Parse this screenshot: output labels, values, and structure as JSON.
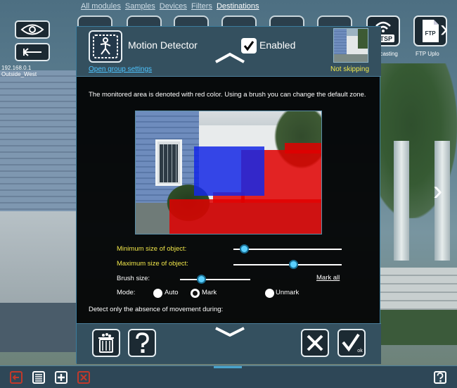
{
  "nav": {
    "items": [
      "All modules",
      "Samples",
      "Devices",
      "Filters",
      "Destinations"
    ],
    "active": "Destinations"
  },
  "camera": {
    "ip": "192.168.0.1",
    "name": "Outside_West"
  },
  "right_modules": [
    {
      "icon": "rtsp-icon",
      "label": "RTSP",
      "caption": "dcasting"
    },
    {
      "icon": "ftp-icon",
      "label": "FTP",
      "caption": "FTP Uplo"
    }
  ],
  "dialog": {
    "title": "Motion Detector",
    "enabled_label": "Enabled",
    "enabled": true,
    "group_link": "Open group settings",
    "status": "Not skipping",
    "description": "The monitored area is denoted with red color. Using a brush you can change the default zone.",
    "controls": {
      "min_size_label": "Minimum size of object:",
      "min_size_value": 0.1,
      "max_size_label": "Maximum size of object:",
      "max_size_value": 0.55,
      "brush_label": "Brush size:",
      "brush_value": 0.3,
      "mark_all": "Mark all",
      "mode_label": "Mode:",
      "modes": [
        "Auto",
        "Mark",
        "Unmark"
      ],
      "mode_selected": "Mark",
      "absence_label": "Detect only the absence of movement during:"
    },
    "footer": {
      "ok_label": "ok"
    }
  },
  "colors": {
    "accent": "#4ec4ff",
    "status": "#f0e64a",
    "zone_red": "#e10000",
    "zone_blue": "#1428e6",
    "close_red": "#c0392b"
  }
}
